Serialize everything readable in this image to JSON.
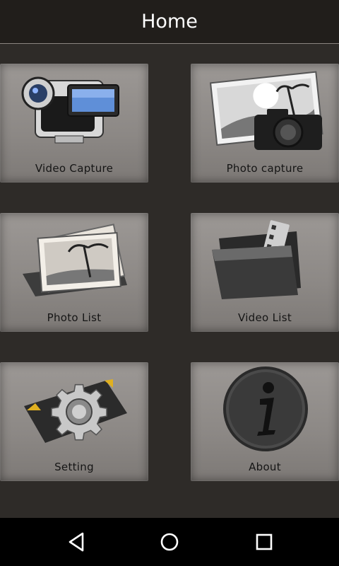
{
  "app_bar": {
    "title": "Home"
  },
  "tiles": [
    {
      "label": "Video Capture",
      "icon": "camcorder-icon"
    },
    {
      "label": "Photo capture",
      "icon": "photo-camera-icon"
    },
    {
      "label": "Photo List",
      "icon": "photo-stack-icon"
    },
    {
      "label": "Video List",
      "icon": "film-folder-icon"
    },
    {
      "label": "Setting",
      "icon": "gear-icon"
    },
    {
      "label": "About",
      "icon": "info-icon"
    }
  ],
  "nav_bar": {
    "buttons": [
      "back-icon",
      "home-icon",
      "recents-icon"
    ]
  },
  "colors": {
    "app_bar_bg": "#211e1b",
    "page_bg": "#2e2b28",
    "tile_bg": "#8f8b88",
    "nav_bg": "#000000"
  }
}
